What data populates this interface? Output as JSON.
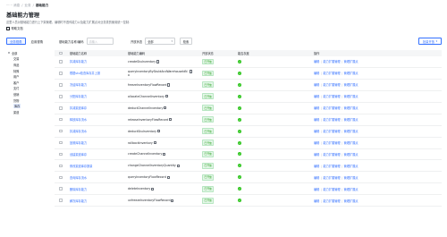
{
  "breadcrumb": {
    "items": [
      "······ 消息",
      "业务",
      "基础能力"
    ]
  },
  "page": {
    "title": "基础能力管理",
    "description": "这里人员对基础能力进行上下架管理，编辑时不透传能力以及能力扩展点对业务类的使用统一控制.",
    "help_doc": "帮助文档"
  },
  "tabs": [
    {
      "label": "业务视角",
      "active": true
    },
    {
      "label": "应用视角",
      "active": false
    }
  ],
  "filters": {
    "name_label": "基础能力名称/编码",
    "name_placeholder": "请输入",
    "status_label": "开放状态",
    "status_value": "全部",
    "search_button": "检索",
    "batch_button": "批量开放"
  },
  "tree": {
    "root": "全部",
    "children": [
      "交易",
      "商品",
      "特殊",
      "用户",
      "客户",
      "支付",
      "营销",
      "货物",
      "库存",
      "渠道"
    ],
    "selected": "库存"
  },
  "table": {
    "columns": [
      "基础能力名称",
      "基础能力编码",
      "开放状态",
      "能否灰度",
      "操作"
    ],
    "status_text": "已开放",
    "switch_glyph": "✓",
    "op_labels": [
      "编辑",
      "能力扩展管理",
      "管理扩展点"
    ],
    "rows": [
      {
        "name": "扣减库存能力",
        "code": "createSkuInventory"
      },
      {
        "name": "根据sku检查库存并上报",
        "code": "queryInventoryBySkuIdAndWarehouseIdNo"
      },
      {
        "name": "冻结库存能力",
        "code": "freezeInventoryFlowRecord"
      },
      {
        "name": "分配库存能力",
        "code": "allocateChannelInventory"
      },
      {
        "name": "扣减渠道库存",
        "code": "deductChannelInventory"
      },
      {
        "name": "释放库存流水",
        "code": "releaseInventoryFlowRecord"
      },
      {
        "name": "扣减库存流水",
        "code": "deductSkuInventory"
      },
      {
        "name": "回滚库存能力",
        "code": "rollbackInventory"
      },
      {
        "name": "创建渠道库存",
        "code": "createChannelInventory"
      },
      {
        "name": "修改渠道库存数量",
        "code": "changeChannelInventoryQuantity"
      },
      {
        "name": "查询库存流水",
        "code": "queryInventoryFlowRecord"
      },
      {
        "name": "删除库存能力",
        "code": "deleteInventory"
      },
      {
        "name": "解冻库存能力",
        "code": "unfreezeInventoryFlowRecord"
      }
    ]
  },
  "colors": {
    "accent": "#3370ff",
    "status_green": "#2ea121",
    "switch_green": "#34c724"
  }
}
